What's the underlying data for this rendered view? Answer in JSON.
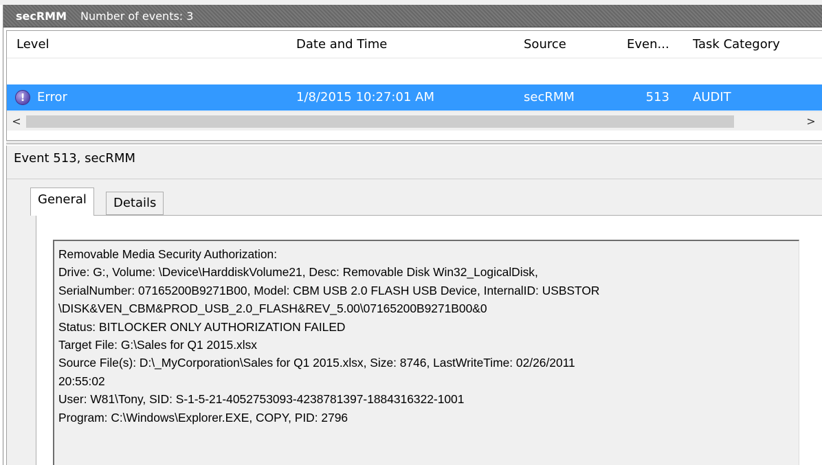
{
  "header": {
    "title": "secRMM",
    "event_count": "Number of events: 3"
  },
  "list": {
    "columns": {
      "level": "Level",
      "date": "Date and Time",
      "source": "Source",
      "event": "Even...",
      "task": "Task Category"
    },
    "selected_row": {
      "level": "Error",
      "date": "1/8/2015 10:27:01 AM",
      "source": "secRMM",
      "event": "513",
      "task": "AUDIT"
    }
  },
  "scrollbar": {
    "left_arrow": "<",
    "right_arrow": ">"
  },
  "details": {
    "title": "Event 513, secRMM",
    "tabs": {
      "general": "General",
      "details": "Details"
    },
    "message_lines": [
      "Removable Media Security Authorization:",
      "Drive: G:, Volume: \\Device\\HarddiskVolume21, Desc: Removable Disk Win32_LogicalDisk,",
      "SerialNumber: 07165200B9271B00, Model: CBM USB 2.0 FLASH USB Device, InternalID: USBSTOR",
      "\\DISK&VEN_CBM&PROD_USB_2.0_FLASH&REV_5.00\\07165200B9271B00&0",
      "Status: BITLOCKER ONLY AUTHORIZATION FAILED",
      "Target File: G:\\Sales for Q1 2015.xlsx",
      "Source File(s): D:\\_MyCorporation\\Sales for Q1 2015.xlsx, Size: 8746, LastWriteTime: 02/26/2011",
      "20:55:02",
      "User: W81\\Tony, SID: S-1-5-21-4052753093-4238781397-1884316322-1001",
      "Program: C:\\Windows\\Explorer.EXE, COPY, PID: 2796"
    ]
  }
}
